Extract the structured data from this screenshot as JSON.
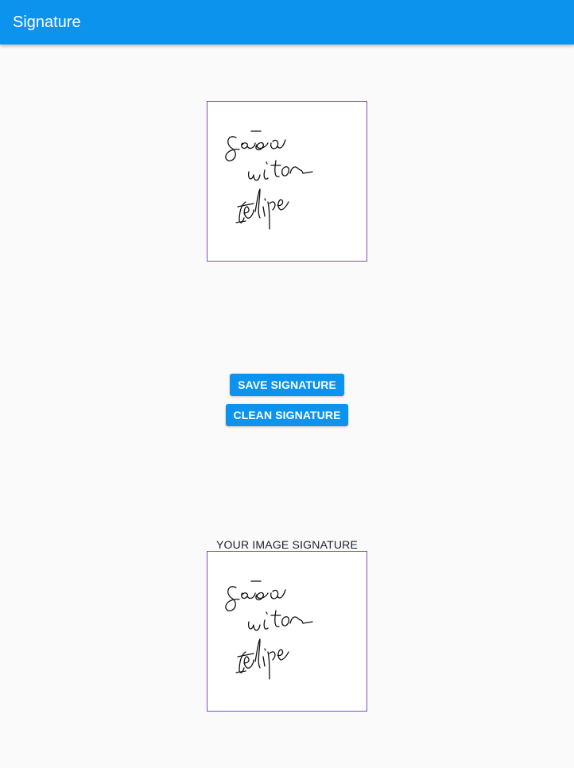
{
  "app_bar": {
    "title": "Signature"
  },
  "actions": {
    "save_label": "SAVE SIGNATURE",
    "clean_label": "CLEAN SIGNATURE"
  },
  "result": {
    "caption": "YOUR IMAGE SIGNATURE"
  },
  "colors": {
    "primary": "#0b93ee",
    "border": "#7a4fc7",
    "ink": "#111111",
    "background": "#fafafa"
  }
}
